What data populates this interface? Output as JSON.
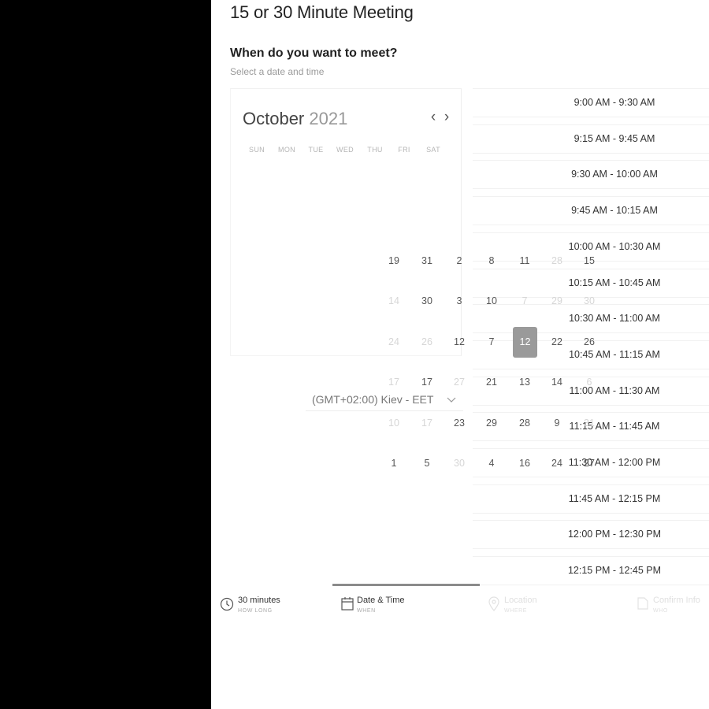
{
  "header": {
    "title": "15 or 30 Minute Meeting",
    "question": "When do you want to meet?",
    "hint": "Select a date and time"
  },
  "calendar": {
    "month": "October",
    "year": "2021",
    "prev_icon": "chevron-left-icon",
    "next_icon": "chevron-right-icon",
    "weekdays": [
      "SUN",
      "MON",
      "TUE",
      "WED",
      "THU",
      "FRI",
      "SAT"
    ],
    "selected_day": "12",
    "rows": [
      [
        {
          "d": "19"
        },
        {
          "d": "31"
        },
        {
          "d": "2"
        },
        {
          "d": "8"
        },
        {
          "d": "11"
        },
        {
          "d": "28",
          "m": true
        },
        {
          "d": "15"
        }
      ],
      [
        {
          "d": "14",
          "m": true
        },
        {
          "d": "30"
        },
        {
          "d": "3"
        },
        {
          "d": "10"
        },
        {
          "d": "7",
          "m": true
        },
        {
          "d": "29",
          "m": true
        },
        {
          "d": "30",
          "m": true
        }
      ],
      [
        {
          "d": "24",
          "m": true
        },
        {
          "d": "26",
          "m": true
        },
        {
          "d": "12"
        },
        {
          "d": "7"
        },
        {
          "d": "12",
          "s": true
        },
        {
          "d": "22"
        },
        {
          "d": "26"
        }
      ],
      [
        {
          "d": "17",
          "m": true
        },
        {
          "d": "17"
        },
        {
          "d": "27",
          "m": true
        },
        {
          "d": "21"
        },
        {
          "d": "13"
        },
        {
          "d": "14"
        },
        {
          "d": "6",
          "m": true
        }
      ],
      [
        {
          "d": "10",
          "m": true
        },
        {
          "d": "17",
          "m": true
        },
        {
          "d": "23"
        },
        {
          "d": "29"
        },
        {
          "d": "28"
        },
        {
          "d": "9"
        },
        {
          "d": "31",
          "m": true
        }
      ],
      [
        {
          "d": "1"
        },
        {
          "d": "5"
        },
        {
          "d": "30",
          "m": true
        },
        {
          "d": "4"
        },
        {
          "d": "16"
        },
        {
          "d": "24"
        },
        {
          "d": "27"
        }
      ]
    ]
  },
  "timezone": {
    "value": "(GMT+02:00) Kiev - EET",
    "icon": "chevron-down-icon"
  },
  "time_slots": [
    "9:00 AM - 9:30 AM",
    "9:15 AM - 9:45 AM",
    "9:30 AM - 10:00 AM",
    "9:45 AM - 10:15 AM",
    "10:00 AM - 10:30 AM",
    "10:15 AM - 10:45 AM",
    "10:30 AM - 11:00 AM",
    "10:45 AM - 11:15 AM",
    "11:00 AM - 11:30 AM",
    "11:15 AM - 11:45 AM",
    "11:30 AM - 12:00 PM",
    "11:45 AM - 12:15 PM",
    "12:00 PM - 12:30 PM",
    "12:15 PM - 12:45 PM"
  ],
  "steps": [
    {
      "label": "30 minutes",
      "sub": "HOW LONG",
      "icon": "clock-icon"
    },
    {
      "label": "Date & Time",
      "sub": "WHEN",
      "icon": "calendar-icon"
    },
    {
      "label": "Location",
      "sub": "WHERE",
      "icon": "location-pin-icon"
    },
    {
      "label": "Confirm Info",
      "sub": "WHO",
      "icon": "document-icon"
    }
  ],
  "colors": {
    "selected_day": "#9a9a9a",
    "progress": "#8b8b8b",
    "muted_text": "#d6d6d6"
  }
}
